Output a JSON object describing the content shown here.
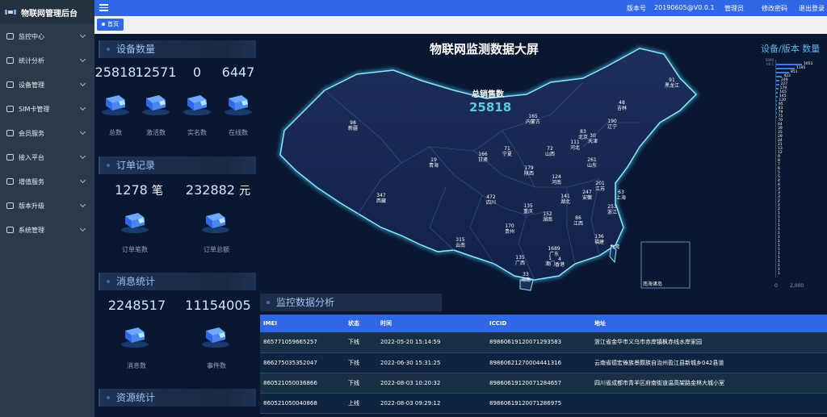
{
  "app": {
    "title": "物联网管理后台"
  },
  "sidebar": {
    "items": [
      {
        "label": "监控中心"
      },
      {
        "label": "统计分析"
      },
      {
        "label": "设备管理"
      },
      {
        "label": "SIM卡管理"
      },
      {
        "label": "会员服务"
      },
      {
        "label": "接入平台"
      },
      {
        "label": "增值服务"
      },
      {
        "label": "版本升级"
      },
      {
        "label": "系统管理"
      }
    ]
  },
  "topbar": {
    "version_label": "版本号",
    "version": "20190605@V0.0.1",
    "admin": "管理员",
    "change_pwd": "修改密码",
    "logout": "退出登录"
  },
  "tabs": [
    {
      "label": "首页"
    }
  ],
  "devices": {
    "title": "设备数量",
    "counts": [
      {
        "value": "25818",
        "label": "总数"
      },
      {
        "value": "12571",
        "label": "激活数"
      },
      {
        "value": "0",
        "label": "实名数"
      },
      {
        "value": "6447",
        "label": "在线数"
      }
    ]
  },
  "orders": {
    "title": "订单记录",
    "count": "1278",
    "count_unit": "笔",
    "amount": "232882",
    "amount_unit": "元",
    "count_label": "订单笔数",
    "amount_label": "订单总额"
  },
  "messages": {
    "title": "消息统计",
    "msg_value": "2248517",
    "event_value": "11154005",
    "msg_label": "消息数",
    "event_label": "事件数"
  },
  "resources": {
    "title": "资源统计"
  },
  "map": {
    "title": "物联网监测数据大屏",
    "sales_label": "总销售数",
    "sales_value": "25818",
    "inset_label": "南海诸岛",
    "provinces": [
      {
        "name": "新疆",
        "value": "98"
      },
      {
        "name": "西藏",
        "value": "347"
      },
      {
        "name": "青海",
        "value": "19"
      },
      {
        "name": "甘肃",
        "value": "166"
      },
      {
        "name": "内蒙古",
        "value": "165"
      },
      {
        "name": "黑龙江",
        "value": "91"
      },
      {
        "name": "吉林",
        "value": "48"
      },
      {
        "name": "辽宁",
        "value": "190"
      },
      {
        "name": "北京",
        "value": "83"
      },
      {
        "name": "天津",
        "value": "30"
      },
      {
        "name": "河北",
        "value": "111"
      },
      {
        "name": "山西",
        "value": "72"
      },
      {
        "name": "宁夏",
        "value": "71"
      },
      {
        "name": "陕西",
        "value": "179"
      },
      {
        "name": "山东",
        "value": "261"
      },
      {
        "name": "河南",
        "value": "124"
      },
      {
        "name": "江苏",
        "value": "201"
      },
      {
        "name": "安徽",
        "value": "247"
      },
      {
        "name": "上海",
        "value": "63"
      },
      {
        "name": "湖北",
        "value": "141"
      },
      {
        "name": "浙江",
        "value": "253"
      },
      {
        "name": "四川",
        "value": "472"
      },
      {
        "name": "重庆",
        "value": "135"
      },
      {
        "name": "湖南",
        "value": "152"
      },
      {
        "name": "江西",
        "value": "86"
      },
      {
        "name": "贵州",
        "value": "170"
      },
      {
        "name": "福建",
        "value": "136"
      },
      {
        "name": "云南",
        "value": "315"
      },
      {
        "name": "广西",
        "value": "135"
      },
      {
        "name": "广东",
        "value": "1689"
      },
      {
        "name": "香港",
        "value": "4"
      },
      {
        "name": "澳门",
        "value": "1"
      },
      {
        "name": "海南",
        "value": "33"
      },
      {
        "name": "台湾",
        "value": ""
      }
    ]
  },
  "version_chart": {
    "title": "设备/版本 数量",
    "ticks": [
      "0",
      "2,000"
    ],
    "bars": [
      {
        "label": "0000",
        "value": ""
      },
      {
        "label": "V0.1",
        "value": "1651"
      },
      {
        "label": "",
        "value": "1195"
      },
      {
        "label": "",
        "value": "851"
      },
      {
        "label": "",
        "value": "422"
      },
      {
        "label": "",
        "value": "249"
      },
      {
        "label": "",
        "value": "227"
      },
      {
        "label": "",
        "value": "179"
      },
      {
        "label": "",
        "value": "165"
      },
      {
        "label": "",
        "value": "145"
      },
      {
        "label": "",
        "value": "120"
      },
      {
        "label": "",
        "value": "95"
      },
      {
        "label": "",
        "value": "83"
      },
      {
        "label": "",
        "value": "79"
      },
      {
        "label": "",
        "value": "75"
      },
      {
        "label": "",
        "value": "70"
      },
      {
        "label": "",
        "value": "44"
      },
      {
        "label": "",
        "value": "39"
      },
      {
        "label": "",
        "value": "35"
      },
      {
        "label": "",
        "value": "28"
      },
      {
        "label": "",
        "value": "24"
      },
      {
        "label": "",
        "value": "21"
      },
      {
        "label": "",
        "value": "13"
      },
      {
        "label": "",
        "value": "12"
      },
      {
        "label": "",
        "value": "9"
      },
      {
        "label": "",
        "value": "8"
      },
      {
        "label": "",
        "value": "7"
      },
      {
        "label": "",
        "value": "6"
      },
      {
        "label": "",
        "value": "5"
      },
      {
        "label": "",
        "value": "5"
      },
      {
        "label": "",
        "value": "4"
      },
      {
        "label": "",
        "value": "4"
      },
      {
        "label": "",
        "value": "3"
      },
      {
        "label": "",
        "value": "3"
      },
      {
        "label": "",
        "value": "3"
      },
      {
        "label": "",
        "value": "2"
      },
      {
        "label": "",
        "value": "2"
      },
      {
        "label": "",
        "value": "2"
      },
      {
        "label": "",
        "value": "1"
      },
      {
        "label": "",
        "value": "1"
      },
      {
        "label": "",
        "value": "1"
      },
      {
        "label": "",
        "value": "1"
      },
      {
        "label": "",
        "value": "1"
      },
      {
        "label": "",
        "value": "1"
      },
      {
        "label": "",
        "value": "1"
      },
      {
        "label": "",
        "value": "1"
      },
      {
        "label": "",
        "value": "1"
      },
      {
        "label": "",
        "value": "1"
      },
      {
        "label": "",
        "value": "1"
      },
      {
        "label": "",
        "value": "1"
      },
      {
        "label": "",
        "value": "1"
      },
      {
        "label": "",
        "value": "1"
      },
      {
        "label": "",
        "value": "1"
      },
      {
        "label": "",
        "value": "1"
      }
    ]
  },
  "analysis": {
    "title": "监控数据分析",
    "columns": [
      "IMEI",
      "状态",
      "时间",
      "ICCID",
      "地址"
    ],
    "rows": [
      [
        "865771059665257",
        "下线",
        "2022-05-20 15:14:59",
        "89860619120071293583",
        "浙江省金华市义乌市赤岸镇枫赤线水岸家园"
      ],
      [
        "866275035352047",
        "下线",
        "2022-06-30 15:31:25",
        "89860621270004441316",
        "云南省德宏傣族景颇族自治州盈江县新城乡042县道"
      ],
      [
        "860521050036866",
        "下线",
        "2022-08-03 10:20:32",
        "89860619120071284657",
        "四川省成都市青羊区府南街道温高架路金林大城小室"
      ],
      [
        "860521050040868",
        "上线",
        "2022-08-03 09:29:12",
        "89860619120071286975",
        ""
      ]
    ]
  }
}
